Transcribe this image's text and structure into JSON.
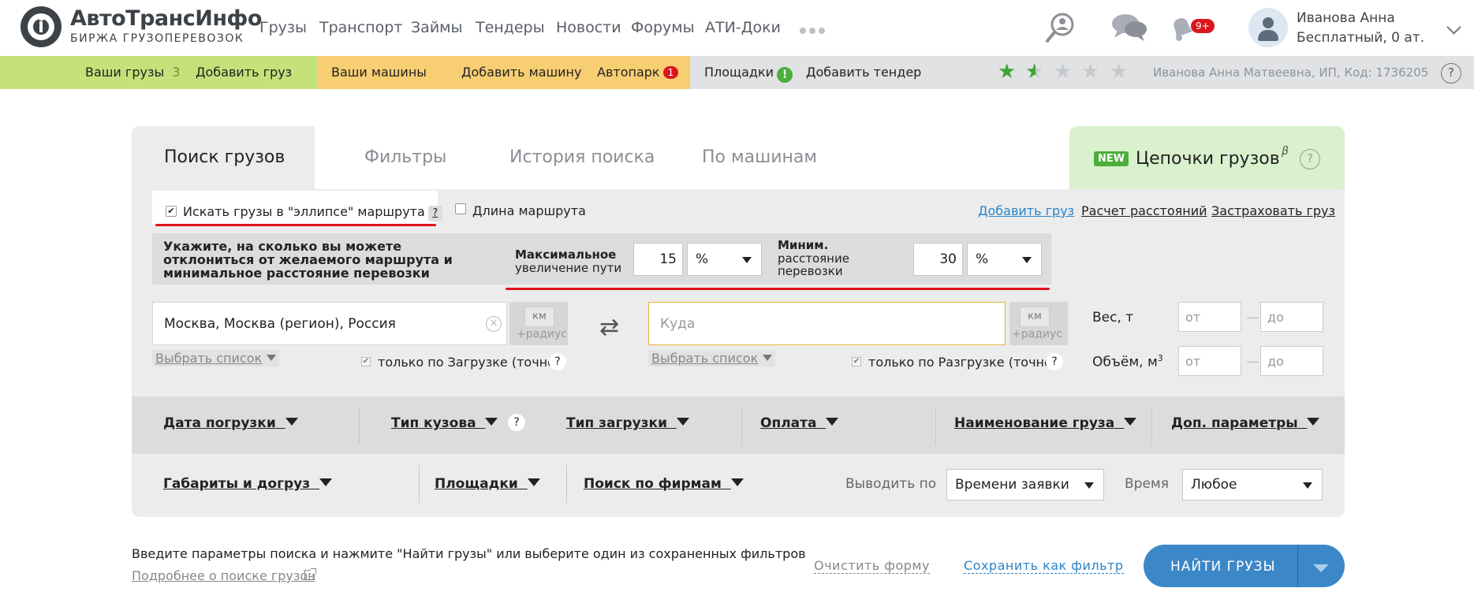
{
  "brand": {
    "title": "АвтоТрансИнфо",
    "subtitle": "БИРЖА ГРУЗОПЕРЕВОЗОК"
  },
  "nav": [
    "Грузы",
    "Транспорт",
    "Займы",
    "Тендеры",
    "Новости",
    "Форумы",
    "АТИ-Доки"
  ],
  "notifications": {
    "badge": "9+"
  },
  "user": {
    "name": "Иванова Анна",
    "plan": "Бесплатный, 0 ат."
  },
  "subbar": {
    "my_cargo": "Ваши грузы",
    "my_cargo_count": "3",
    "add_cargo": "Добавить груз",
    "my_trucks": "Ваши машины",
    "add_truck": "Добавить машину",
    "fleet": "Автопарк",
    "fleet_badge": "1",
    "platforms": "Площадки",
    "platforms_badge": "!",
    "add_tender": "Добавить тендер",
    "rating": 1.5,
    "profile": "Иванова Анна Матвеевна, ИП,  Код: 1736205",
    "help": "?"
  },
  "tabs": {
    "search": "Поиск грузов",
    "filters": "Фильтры",
    "history": "История поиска",
    "by_trucks": "По машинам",
    "chains_badge": "NEW",
    "chains": "Цепочки грузов",
    "beta": "β",
    "chains_help": "?"
  },
  "options": {
    "ellipse": "Искать грузы в \"эллипсе\" маршрута",
    "ellipse_checked": true,
    "ellipse_help": "?",
    "route_length": "Длина маршрута",
    "add_cargo_link": "Добавить груз",
    "distance_calc": "Расчет расстояний",
    "insure": "Застраховать груз"
  },
  "deviation": {
    "text": "Укажите, на сколько вы можете отклонить­ся от желаемого маршрута и минимальное расстояние перевозки",
    "max_title": "Максимальное",
    "max_sub": "увеличение пути",
    "max_value": "15",
    "max_unit": "%",
    "min_title": "Миним.",
    "min_sub1": "расстояние",
    "min_sub2": "перевозки",
    "min_value": "30",
    "min_unit": "%"
  },
  "route": {
    "from": "Москва, Москва (регион), Россия",
    "to_placeholder": "Куда",
    "km": "км",
    "radius": "+радиус",
    "choose_list": "Выбрать список",
    "only_loading": "только по Загрузке (точно)",
    "only_unloading": "только по Разгрузке (точно)",
    "help": "?"
  },
  "weight": {
    "label": "Вес, т",
    "from": "от",
    "to": "до"
  },
  "volume": {
    "label": "Объём, м",
    "sup": "3",
    "from": "от",
    "to": "до"
  },
  "filters": {
    "load_date": "Дата погрузки",
    "body_type": "Тип кузова",
    "body_help": "?",
    "load_type": "Тип загрузки",
    "payment": "Оплата",
    "cargo_name": "Наименование груза",
    "extra": "Доп. параметры",
    "dimensions": "Габариты и догруз",
    "platforms": "Площадки",
    "company_search": "Поиск по фирмам"
  },
  "sort": {
    "label": "Выводить по",
    "value": "Времени заявки",
    "time_label": "Время",
    "time_value": "Любое"
  },
  "footer": {
    "hint": "Введите параметры поиска и нажмите \"Найти грузы\" или выберите один из сохраненных фильтров",
    "more": "Подробнее о поиске грузов",
    "clear": "Очистить форму",
    "save": "Сохранить как фильтр",
    "find": "НАЙТИ ГРУЗЫ"
  }
}
